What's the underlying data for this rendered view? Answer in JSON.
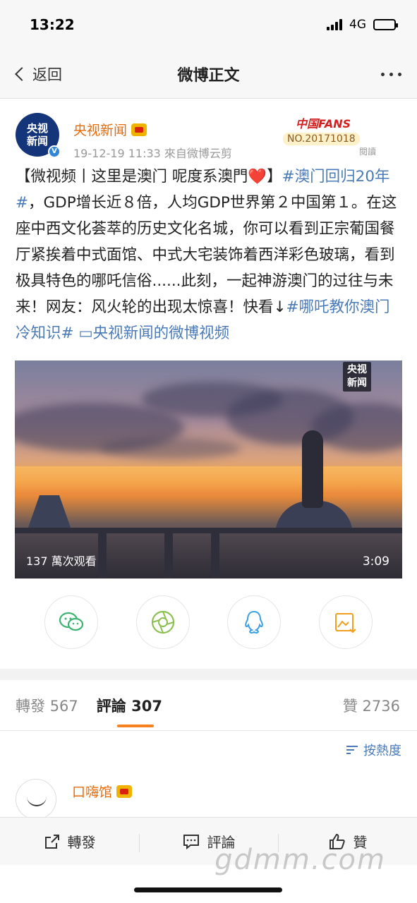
{
  "status": {
    "time": "13:22",
    "network": "4G"
  },
  "nav": {
    "back_label": "返回",
    "title": "微博正文"
  },
  "post": {
    "author": "央视新闻",
    "avatar_text_top": "央视",
    "avatar_text_bottom": "新闻",
    "time": "19-12-19 11:33",
    "source": "來自微博云剪",
    "fans_badge": {
      "title": "中国FANS",
      "number": "NO.20171018",
      "read": "閱讀"
    },
    "text_part1": "【微视频丨这里是澳门 呢度系澳門",
    "heart": "❤️",
    "text_part2": "】",
    "tag1": "#澳门回归20年#",
    "text_part3": "，GDP增长近８倍，人均GDP世界第２中国第１。在这座中西文化荟萃的历史文化名城，你可以看到正宗葡国餐厅紧挨着中式面馆、中式大宅装饰着西洋彩色玻璃，看到极具特色的哪吒信俗......此刻，一起神游澳门的过往与未来！网友：风火轮的出现太惊喜！快看↓",
    "tag2": "#哪吒教你澳门冷知识#",
    "video_link": " ▭央视新闻的微博视频"
  },
  "video": {
    "logo_top": "央视",
    "logo_bottom": "新闻",
    "views": "137 萬次观看",
    "duration": "3:09"
  },
  "share": {
    "items": [
      {
        "icon": "wechat-icon",
        "color": "#3cb371"
      },
      {
        "icon": "moments-icon",
        "color": "#8cc152"
      },
      {
        "icon": "qq-icon",
        "color": "#3aa0e0"
      },
      {
        "icon": "save-image-icon",
        "color": "#f0a020"
      }
    ]
  },
  "tabs": {
    "repost_label": "轉發",
    "repost_count": "567",
    "comment_label": "評論",
    "comment_count": "307",
    "like_label": "贊",
    "like_count": "2736",
    "accent": "#f7801f"
  },
  "sort": {
    "label": "按熱度"
  },
  "comment": {
    "name": "口嗨馆"
  },
  "bottom_bar": {
    "repost": "轉發",
    "comment": "評論",
    "like": "贊"
  },
  "watermark": "gdmm.com"
}
